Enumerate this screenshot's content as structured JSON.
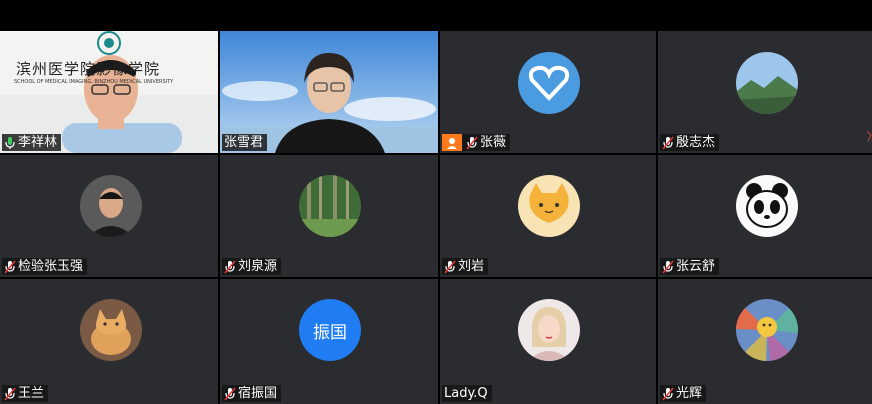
{
  "participants": [
    {
      "name": "李祥林",
      "mic": "active",
      "host": false,
      "avatar": "video-banner"
    },
    {
      "name": "张雪君",
      "mic": "none",
      "host": false,
      "avatar": "video-sky"
    },
    {
      "name": "张薇",
      "mic": "muted",
      "host": true,
      "avatar": "heart-cloud-photo"
    },
    {
      "name": "殷志杰",
      "mic": "muted",
      "host": false,
      "avatar": "mountain-landscape-photo"
    },
    {
      "name": "检验张玉强",
      "mic": "muted",
      "host": false,
      "avatar": "man-portrait-photo"
    },
    {
      "name": "刘泉源",
      "mic": "muted",
      "host": false,
      "avatar": "forest-photo"
    },
    {
      "name": "刘岩",
      "mic": "muted",
      "host": false,
      "avatar": "cartoon-cat"
    },
    {
      "name": "张云舒",
      "mic": "muted",
      "host": false,
      "avatar": "panda-drawing"
    },
    {
      "name": "王兰",
      "mic": "muted",
      "host": false,
      "avatar": "cat-photo"
    },
    {
      "name": "宿振国",
      "mic": "muted",
      "host": false,
      "avatar": "text-avatar",
      "avatar_text": "振国"
    },
    {
      "name": "Lady.Q",
      "mic": "none",
      "host": false,
      "avatar": "woman-portrait-photo"
    },
    {
      "name": "光辉",
      "mic": "muted",
      "host": false,
      "avatar": "colorful-flower-drawing"
    }
  ],
  "banner": {
    "title": "滨州医学院影像学院",
    "subtitle": "SCHOOL OF MEDICAL IMAGING, BINZHOU MEDICAL UNIVERSITY"
  },
  "colors": {
    "active_border": "#2aa54c",
    "host_badge": "#ff7a1a",
    "tile_bg": "#2b2c2f",
    "text_avatar": "#1f7cf2"
  }
}
